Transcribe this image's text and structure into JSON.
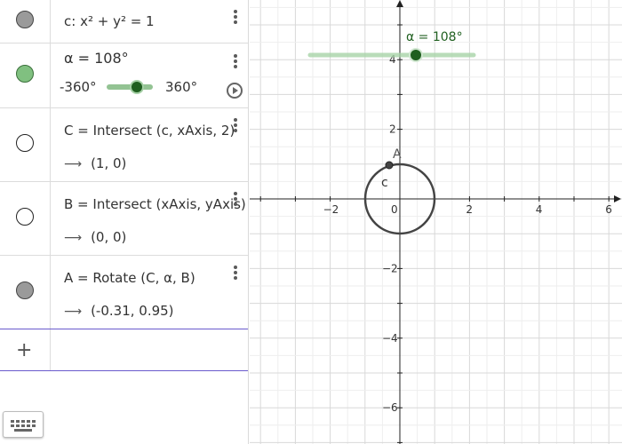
{
  "algebra": {
    "rows": [
      {
        "def": "c: x² + y² = 1"
      },
      {
        "def": "α = 108°",
        "slider_min": "-360°",
        "slider_max": "360°"
      },
      {
        "def": "C = Intersect (c, xAxis, 2)",
        "value": "(1, 0)"
      },
      {
        "def": "B = Intersect (xAxis, yAxis)",
        "value": "(0, 0)"
      },
      {
        "def": "A = Rotate (C, α, B)",
        "value": "(-0.31, 0.95)"
      }
    ],
    "arrow": "⟶",
    "add": "+"
  },
  "graphics": {
    "slider_label": "α = 108°",
    "x_ticks": [
      "−2",
      "0",
      "2",
      "4",
      "6"
    ],
    "y_ticks": [
      "4",
      "2",
      "−2",
      "−4",
      "−6"
    ],
    "point_A_label": "A",
    "circle_label": "c",
    "colors": {
      "slider": "#1f5f1f",
      "circle": "#444444",
      "grid": "#e6e6e6"
    }
  }
}
